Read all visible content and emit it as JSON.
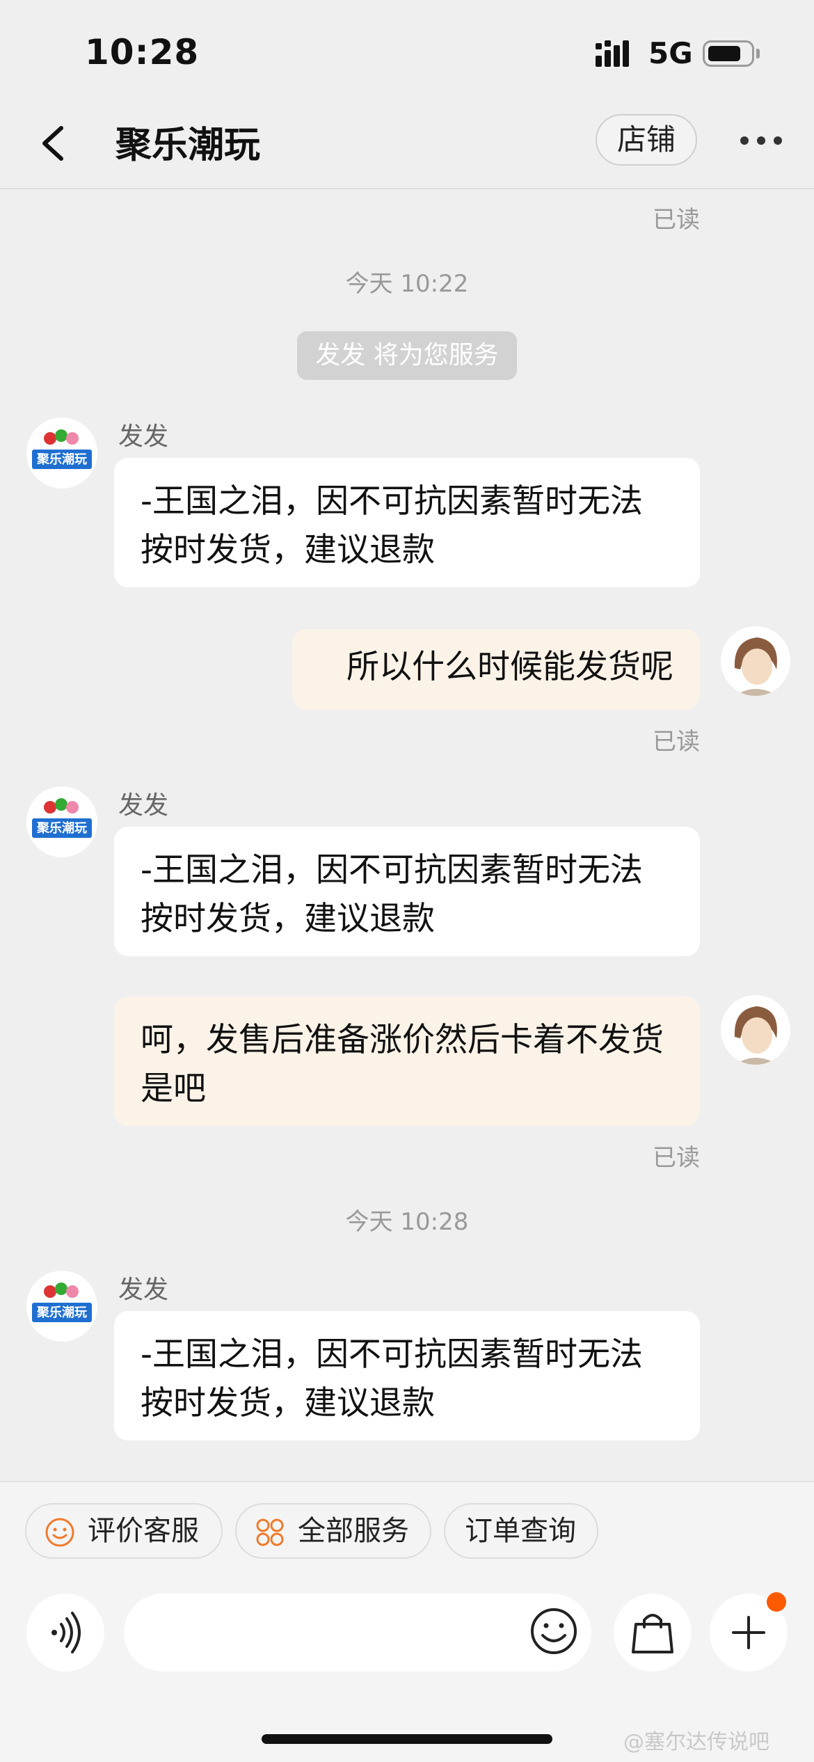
{
  "status": {
    "time": "10:28",
    "network": "5G"
  },
  "nav": {
    "title": "聚乐潮玩",
    "shop_label": "店铺"
  },
  "chat": {
    "read_label": "已读",
    "times": [
      "今天 10:22",
      "今天 10:28"
    ],
    "system_notice": "发发 将为您服务",
    "sender_name": "发发",
    "avatar_text": "聚乐潮玩",
    "messages": [
      {
        "from": "shop",
        "text": "-王国之泪，因不可抗因素暂时无法按时发货，建议退款"
      },
      {
        "from": "user",
        "text": "所以什么时候能发货呢"
      },
      {
        "from": "shop",
        "text": "-王国之泪，因不可抗因素暂时无法按时发货，建议退款"
      },
      {
        "from": "user",
        "text": "呵，发售后准备涨价然后卡着不发货是吧"
      },
      {
        "from": "shop",
        "text": "-王国之泪，因不可抗因素暂时无法按时发货，建议退款"
      }
    ]
  },
  "quick_actions": [
    {
      "label": "评价客服",
      "icon": "smile-icon"
    },
    {
      "label": "全部服务",
      "icon": "grid-icon"
    },
    {
      "label": "订单查询",
      "icon": ""
    }
  ],
  "input": {
    "placeholder": ""
  },
  "watermark": "@塞尔达传说吧",
  "colors": {
    "accent": "#ff5a00",
    "user_bubble": "#fbf3e8",
    "shop_bubble": "#ffffff"
  }
}
